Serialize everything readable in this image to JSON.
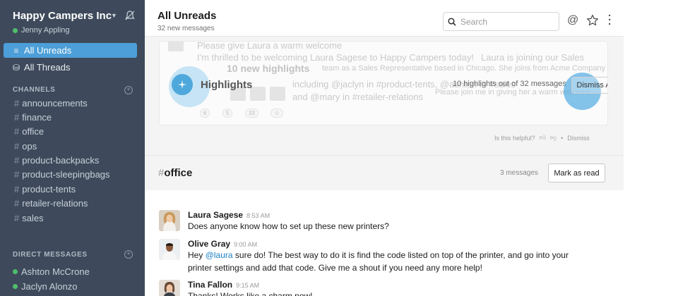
{
  "sidebar": {
    "team_name": "Happy Campers Inc",
    "user_name": "Jenny Appling",
    "nav": [
      {
        "label": "All Unreads",
        "icon": "unreads-icon"
      },
      {
        "label": "All Threads",
        "icon": "threads-icon"
      }
    ],
    "channels_header": "CHANNELS",
    "channels": [
      "announcements",
      "finance",
      "office",
      "ops",
      "product-backpacks",
      "product-sleepingbags",
      "product-tents",
      "retailer-relations",
      "sales"
    ],
    "dm_header": "DIRECT MESSAGES",
    "dms": [
      "Ashton McCrone",
      "Jaclyn Alonzo"
    ]
  },
  "header": {
    "title": "All Unreads",
    "subtitle": "32 new messages",
    "search_placeholder": "Search",
    "mention_symbol": "@"
  },
  "highlights": {
    "title": "Highlights",
    "count_text": "10 highlights out of 32 messages",
    "dismiss_all": "Dismiss All",
    "ghost_line1": "Please give Laura a warm welcome",
    "ghost_line2": "I'm thrilled to be welcoming Laura Sagese to Happy Campers today!",
    "ghost_line2b": "Laura is joining our Sales",
    "ghost_heading": "10 new highlights",
    "ghost_line3": "team as a Sales Representative based in Chicago. She joins from Acme Company",
    "ghost_line4": "including @jaclyn in #product-tents, @ashton in #sales",
    "ghost_line4b": "Please join me in giving her a warm welcome",
    "ghost_line5": "and @mary in #retailer-relations",
    "ghost_reactions": [
      "6",
      "5",
      "33"
    ],
    "helpful_text": "Is this helpful?",
    "helpful_dismiss": "Dismiss"
  },
  "channel": {
    "name": "office",
    "count": "3 messages",
    "mark_read": "Mark as read"
  },
  "messages": [
    {
      "name": "Laura Sagese",
      "time": "8:53 AM",
      "lines": [
        "Does anyone know how to set up these new printers?"
      ]
    },
    {
      "name": "Olive Gray",
      "time": "9:00 AM",
      "mention": "@laura",
      "line1_rest": " sure do! The best way to do it is find the code listed on top of the printer, and go into your",
      "line1_prefix": "Hey ",
      "line2": "printer settings and add that code. Give me a shout if you need any more help!"
    },
    {
      "name": "Tina Fallon",
      "time": "9:15 AM",
      "lines": [
        "Thanks! Works like a charm now!"
      ]
    }
  ],
  "colors": {
    "sidebar_bg": "#3e4a5b",
    "active_item": "#4c9fd8",
    "presence_green": "#4fbf6b",
    "highlight_blue": "#4fa8dc",
    "mention_blue": "#1f80c8"
  }
}
